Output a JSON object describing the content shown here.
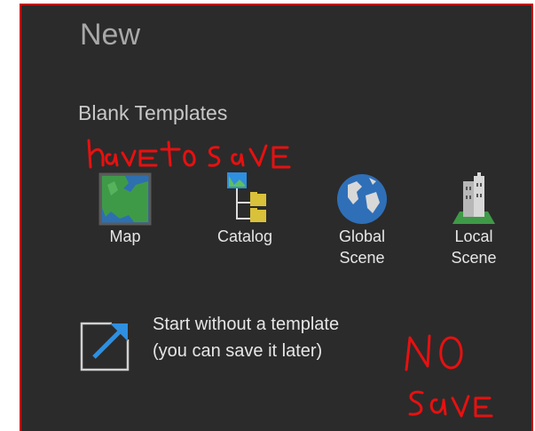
{
  "page": {
    "title": "New",
    "section_label": "Blank Templates"
  },
  "templates": [
    {
      "label": "Map",
      "icon": "map-icon"
    },
    {
      "label": "Catalog",
      "icon": "catalog-icon"
    },
    {
      "label": "Global\nScene",
      "icon": "globe-icon"
    },
    {
      "label": "Local\nScene",
      "icon": "local-scene-icon"
    }
  ],
  "start_without_template": {
    "line1": "Start without a template",
    "line2": "(you can save it later)",
    "icon": "open-external-icon"
  },
  "annotations": {
    "top_note": "have to save",
    "bottom_note": "NO SAVE",
    "color": "#e81010"
  },
  "colors": {
    "background": "#2b2b2b",
    "border": "#c01818",
    "accent": "#2f8fe0"
  }
}
